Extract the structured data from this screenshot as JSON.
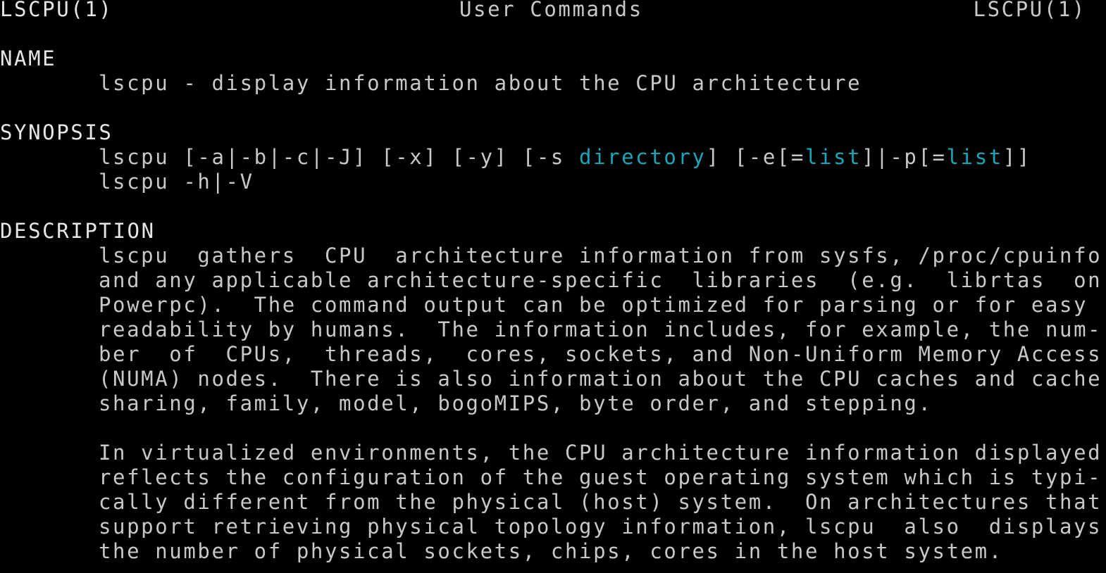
{
  "header": {
    "left": "LSCPU(1)",
    "center": "User Commands",
    "right": "LSCPU(1)"
  },
  "name_section": {
    "heading": "NAME",
    "text": "lscpu - display information about the CPU architecture"
  },
  "synopsis_section": {
    "heading": "SYNOPSIS",
    "line1_parts": [
      "lscpu [-a|-b|-c|-J] [-x] [-y] [-s ",
      "directory",
      "] [-e[=",
      "list",
      "]|-p[=",
      "list",
      "]]"
    ],
    "line2": "lscpu -h|-V"
  },
  "description_section": {
    "heading": "DESCRIPTION",
    "para1": [
      "lscpu  gathers  CPU  architecture information from sysfs, /proc/cpuinfo",
      "and any applicable architecture-specific  libraries  (e.g.  librtas  on",
      "Powerpc).  The command output can be optimized for parsing or for easy",
      "readability by humans.  The information includes, for example, the num-",
      "ber  of  CPUs,  threads,  cores, sockets, and Non-Uniform Memory Access",
      "(NUMA) nodes.  There is also information about the CPU caches and cache",
      "sharing, family, model, bogoMIPS, byte order, and stepping."
    ],
    "para2": [
      "In virtualized environments, the CPU architecture information displayed",
      "reflects the configuration of the guest operating system which is typi-",
      "cally different from the physical (host) system.  On architectures that",
      "support retrieving physical topology information, lscpu  also  displays",
      "the number of physical sockets, chips, cores in the host system."
    ]
  },
  "colors": {
    "background": "#000000",
    "text": "#c8c8c8",
    "highlight": "#1aa6b7"
  }
}
